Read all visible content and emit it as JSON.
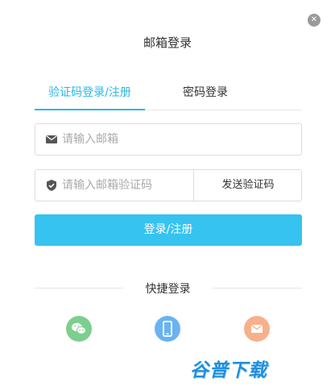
{
  "dialog": {
    "title": "邮箱登录",
    "close_icon": "close-icon"
  },
  "tabs": [
    {
      "label": "验证码登录/注册",
      "active": true
    },
    {
      "label": "密码登录",
      "active": false
    }
  ],
  "email": {
    "icon": "envelope-icon",
    "placeholder": "请输入邮箱",
    "value": ""
  },
  "code": {
    "icon": "shield-icon",
    "placeholder": "请输入邮箱验证码",
    "value": "",
    "send_label": "发送验证码"
  },
  "login_button": {
    "label": "登录/注册"
  },
  "quick_login": {
    "title": "快捷登录",
    "items": [
      {
        "icon": "wechat-icon",
        "color": "#7ccf8e"
      },
      {
        "icon": "phone-icon",
        "color": "#6ab3f1"
      },
      {
        "icon": "mail-icon",
        "color": "#f7b08b"
      }
    ]
  },
  "watermark": {
    "text": "谷普下载"
  },
  "colors": {
    "accent": "#29b7e8",
    "button": "#36c3f0"
  }
}
